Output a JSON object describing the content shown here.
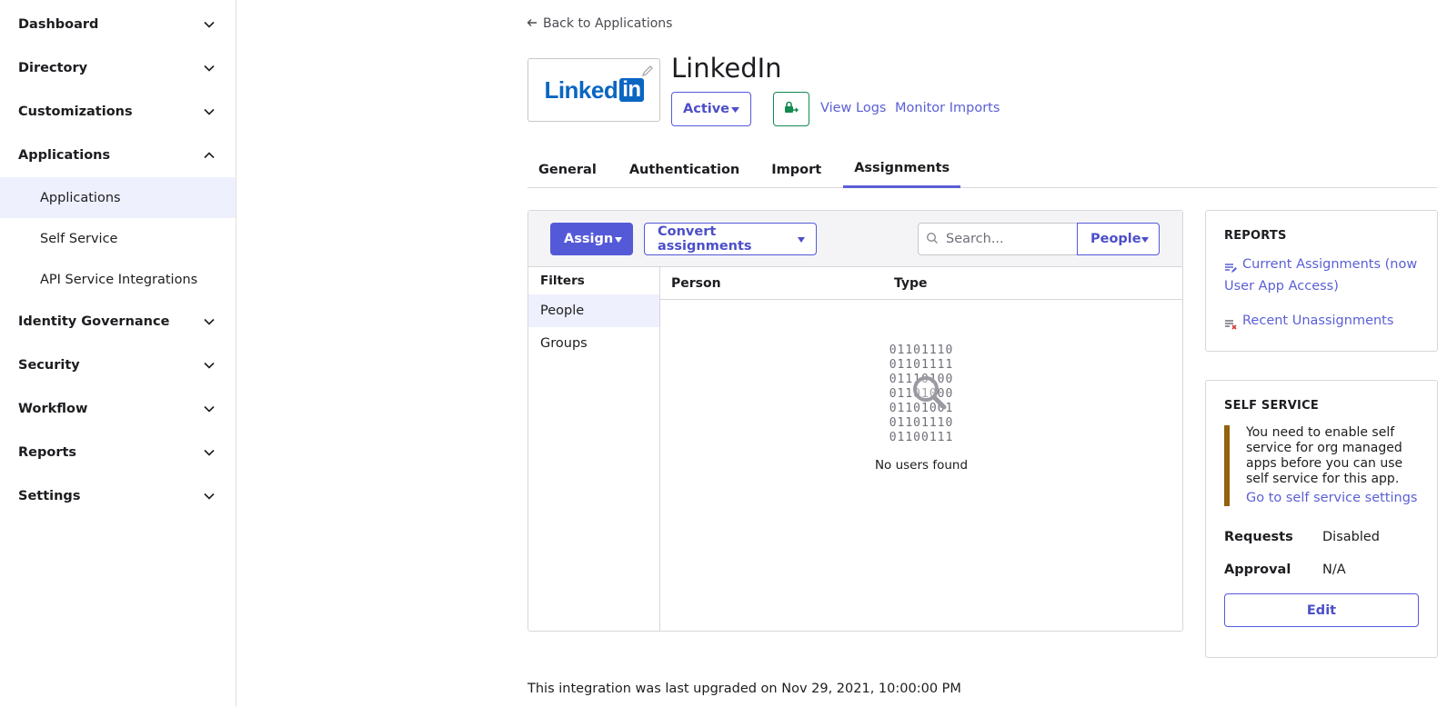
{
  "sidebar": {
    "sections": [
      {
        "label": "Dashboard",
        "icon": "chevron-down-icon"
      },
      {
        "label": "Directory",
        "icon": "chevron-down-icon"
      },
      {
        "label": "Customizations",
        "icon": "chevron-down-icon"
      },
      {
        "label": "Applications",
        "icon": "chevron-up-icon"
      },
      {
        "label": "Identity Governance",
        "icon": "chevron-down-icon"
      },
      {
        "label": "Security",
        "icon": "chevron-down-icon"
      },
      {
        "label": "Workflow",
        "icon": "chevron-down-icon"
      },
      {
        "label": "Reports",
        "icon": "chevron-down-icon"
      },
      {
        "label": "Settings",
        "icon": "chevron-down-icon"
      }
    ],
    "applications_sub": [
      {
        "label": "Applications",
        "selected": true
      },
      {
        "label": "Self Service",
        "selected": false
      },
      {
        "label": "API Service Integrations",
        "selected": false
      }
    ]
  },
  "header": {
    "back_link": "Back to Applications",
    "app_name": "LinkedIn",
    "logo_text": "Linked",
    "logo_in": "in",
    "status": "Active",
    "view_logs": "View Logs",
    "monitor_imports": "Monitor Imports"
  },
  "tabs": [
    {
      "label": "General",
      "active": false
    },
    {
      "label": "Authentication",
      "active": false
    },
    {
      "label": "Import",
      "active": false
    },
    {
      "label": "Assignments",
      "active": true
    }
  ],
  "assignments": {
    "assign_button": "Assign",
    "convert_button": "Convert assignments",
    "search_placeholder": "Search...",
    "search_scope": "People",
    "filters_title": "Filters",
    "filters": [
      {
        "label": "People",
        "selected": true
      },
      {
        "label": "Groups",
        "selected": false
      }
    ],
    "columns": [
      "Person",
      "Type"
    ],
    "empty_binary": [
      "01101110",
      "01101111",
      "01110100",
      "01101000",
      "01101001",
      "01101110",
      "01100111"
    ],
    "empty_message": "No users found"
  },
  "reports": {
    "title": "REPORTS",
    "links": [
      {
        "label": "Current Assignments (now User App Access)",
        "icon": "report-edit-icon"
      },
      {
        "label": "Recent Unassignments",
        "icon": "report-remove-icon"
      }
    ]
  },
  "self_service": {
    "title": "SELF SERVICE",
    "callout_text": "You need to enable self service for org managed apps before you can use self service for this app.",
    "callout_link": "Go to self service settings",
    "requests_label": "Requests",
    "requests_value": "Disabled",
    "approval_label": "Approval",
    "approval_value": "N/A",
    "edit_button": "Edit"
  },
  "footer": {
    "note": "This integration was last upgraded on Nov 29, 2021, 10:00:00 PM"
  },
  "colors": {
    "accent": "#5459d8",
    "link": "#5b5fd4",
    "linkedin_blue": "#0a66c2",
    "warning_bar": "#93620d",
    "selected_bg": "#eef0fd"
  }
}
